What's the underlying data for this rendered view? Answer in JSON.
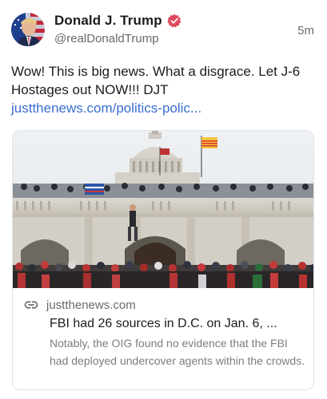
{
  "post": {
    "author_name": "Donald J. Trump",
    "handle": "@realDonaldTrump",
    "timestamp": "5m",
    "text": "Wow! This is big news. What a disgrace. Let J-6 Hostages out NOW!!! DJT",
    "link_text": "justthenews.com/politics-polic..."
  },
  "link_card": {
    "domain": "justthenews.com",
    "title": "FBI had 26 sources in D.C. on Jan. 6, ...",
    "description": "Notably, the OIG found no evidence that the FBI had deployed undercover agents within the crowds."
  },
  "colors": {
    "verified_badge": "#e0475e",
    "link": "#3a6ecf",
    "secondary_text": "#666a70"
  },
  "icons": {
    "verified": "verified-badge-icon",
    "link": "chain-link-icon"
  }
}
